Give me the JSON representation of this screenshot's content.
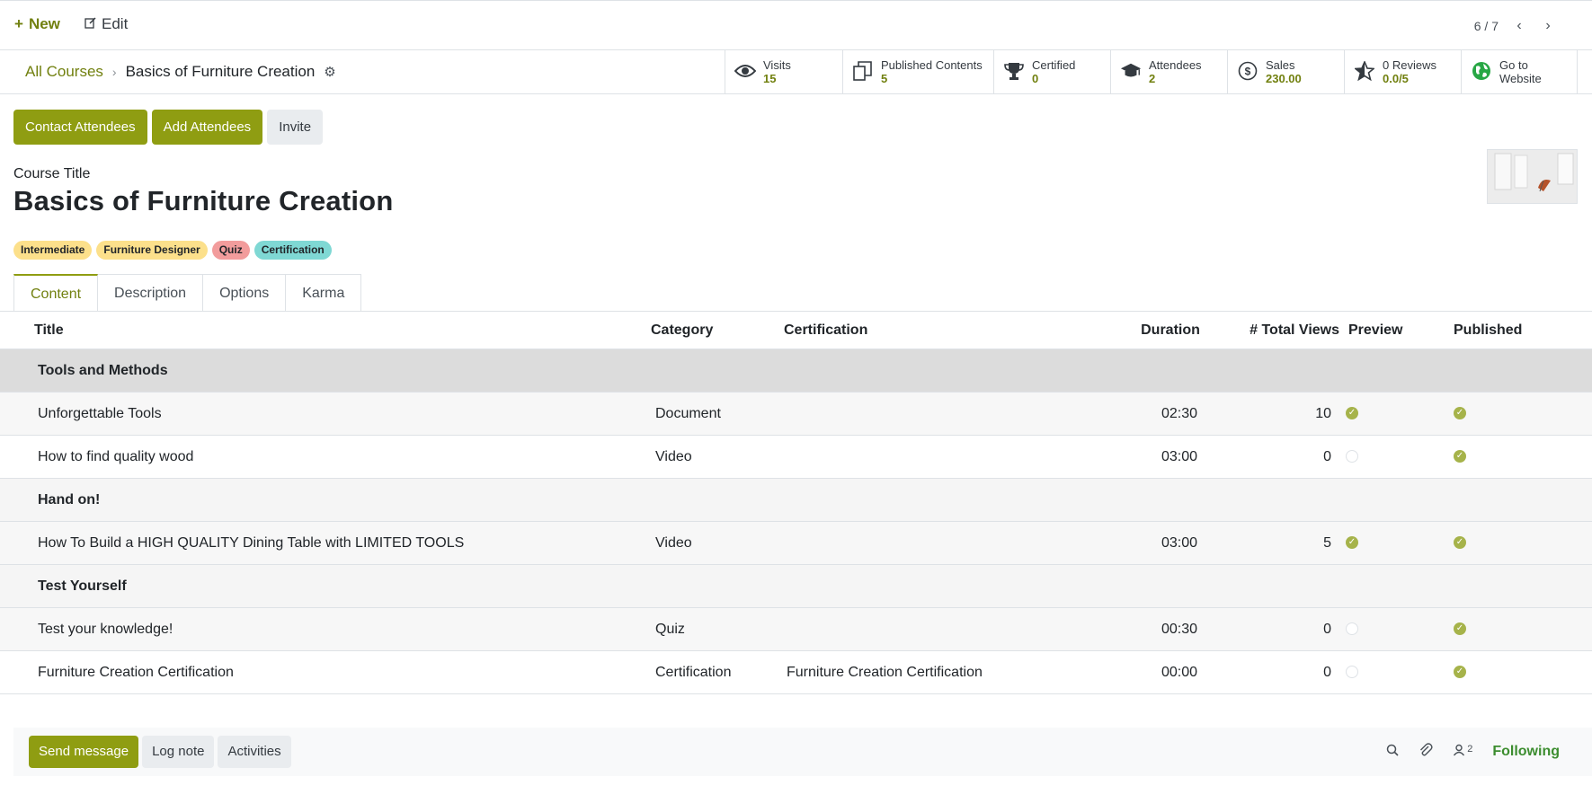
{
  "topbar": {
    "new_label": "New",
    "edit_label": "Edit",
    "pager": "6 / 7"
  },
  "breadcrumb": {
    "parent": "All Courses",
    "current": "Basics of Furniture Creation"
  },
  "stats": [
    {
      "label": "Visits",
      "value": "15",
      "icon": "eye-icon"
    },
    {
      "label": "Published Contents",
      "value": "5",
      "icon": "copy-icon"
    },
    {
      "label": "Certified",
      "value": "0",
      "icon": "trophy-icon"
    },
    {
      "label": "Attendees",
      "value": "2",
      "icon": "graduation-cap-icon"
    },
    {
      "label": "Sales",
      "value": "230.00",
      "icon": "dollar-icon"
    },
    {
      "label": "0 Reviews",
      "value": "0.0/5",
      "icon": "star-icon"
    },
    {
      "label": "Go to",
      "value": "Website",
      "icon": "globe-icon"
    }
  ],
  "actions": {
    "contact": "Contact Attendees",
    "add": "Add Attendees",
    "invite": "Invite"
  },
  "course": {
    "title_label": "Course Title",
    "title": "Basics of Furniture Creation"
  },
  "tags": [
    {
      "label": "Intermediate",
      "color": "#fce08b"
    },
    {
      "label": "Furniture Designer",
      "color": "#fce08b"
    },
    {
      "label": "Quiz",
      "color": "#f29c9c"
    },
    {
      "label": "Certification",
      "color": "#7fd8d4"
    }
  ],
  "tabs": [
    "Content",
    "Description",
    "Options",
    "Karma"
  ],
  "table": {
    "headers": [
      "Title",
      "Category",
      "Certification",
      "Duration",
      "# Total Views",
      "Preview",
      "Published"
    ],
    "rows": [
      {
        "section": "Tools and Methods"
      },
      {
        "title": "Unforgettable Tools",
        "category": "Document",
        "certification": "",
        "duration": "02:30",
        "views": "10",
        "preview": true,
        "published": true
      },
      {
        "title": "How to find quality wood",
        "category": "Video",
        "certification": "",
        "duration": "03:00",
        "views": "0",
        "preview": false,
        "published": true
      },
      {
        "section": "Hand on!"
      },
      {
        "title": "How To Build a HIGH QUALITY Dining Table with LIMITED TOOLS",
        "category": "Video",
        "certification": "",
        "duration": "03:00",
        "views": "5",
        "preview": true,
        "published": true
      },
      {
        "section": "Test Yourself"
      },
      {
        "title": "Test your knowledge!",
        "category": "Quiz",
        "certification": "",
        "duration": "00:30",
        "views": "0",
        "preview": false,
        "published": true
      },
      {
        "title": "Furniture Creation Certification",
        "category": "Certification",
        "certification": "Furniture Creation Certification",
        "duration": "00:00",
        "views": "0",
        "preview": false,
        "published": true
      }
    ]
  },
  "chatter": {
    "send": "Send message",
    "log": "Log note",
    "activities": "Activities",
    "followers_count": "2",
    "following": "Following"
  },
  "colors": {
    "primary": "#8f9d12",
    "link": "#71800f"
  }
}
